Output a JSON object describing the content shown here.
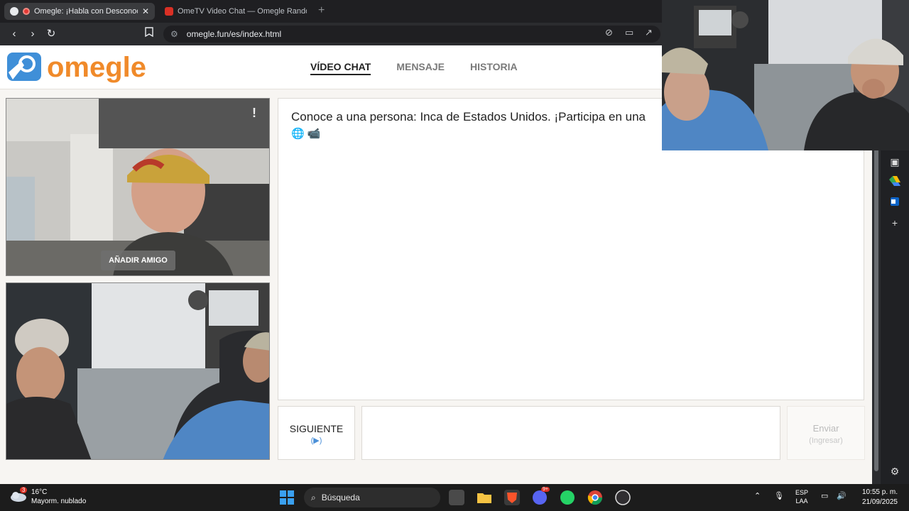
{
  "browser": {
    "tabs": [
      {
        "title": "Omegle: ¡Habla con Desconocidos!",
        "active": true
      },
      {
        "title": "OmeTV Video Chat — Omegle Random Chat",
        "active": false
      }
    ],
    "url": "omegle.fun/es/index.html"
  },
  "site": {
    "logo_text": "omegle",
    "nav": [
      "VÍDEO CHAT",
      "MENSAJE",
      "HISTORIA"
    ],
    "add_friend_label": "AÑADIR AMIGO",
    "report_label": "!",
    "chat_message": "Conoce a una persona: Inca de Estados Unidos. ¡Participa en una",
    "chat_icons": "🌐 📹",
    "next_label": "SIGUIENTE",
    "next_sub": "(▶)",
    "send_label": "Enviar",
    "send_sub": "(Ingresar)"
  },
  "taskbar": {
    "weather_temp": "16°C",
    "weather_desc": "Mayorm. nublado",
    "weather_badge": "3",
    "search_placeholder": "Búsqueda",
    "lang_top": "ESP",
    "lang_bottom": "LAA",
    "time": "10:55 p. m.",
    "date": "21/09/2025",
    "discord_badge": "9+"
  },
  "colors": {
    "brand_orange": "#f08a2a",
    "brand_blue": "#4a8fd8"
  }
}
